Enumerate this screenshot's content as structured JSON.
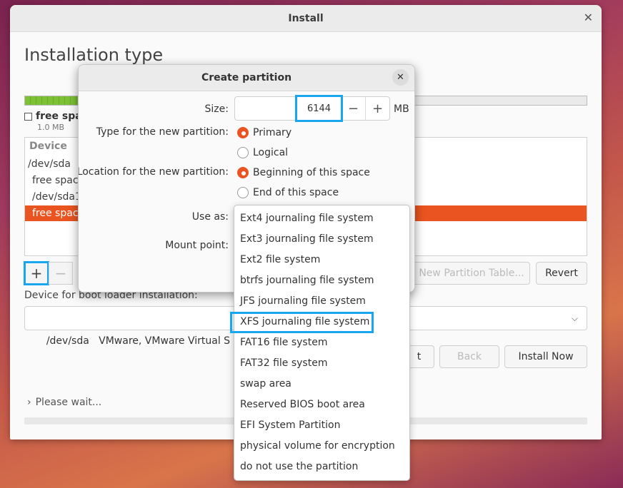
{
  "installer": {
    "title": "Install",
    "close_glyph": "✕",
    "heading": "Installation type",
    "legend_label": "free spa",
    "legend_size": "1.0 MB",
    "device_column": "Device",
    "devices": [
      "/dev/sda",
      "free space",
      "/dev/sda1",
      "free space"
    ],
    "add_glyph": "+",
    "remove_glyph": "−",
    "new_table_label": "New Partition Table...",
    "revert_label": "Revert",
    "boot_label": "Device for boot loader installation:",
    "boot_value": "/dev/sda   VMware, VMware Virtual S (21",
    "back_partial_label": "t",
    "back_label": "Back",
    "install_label": "Install Now",
    "wait_text": "Please wait..."
  },
  "dialog": {
    "title": "Create partition",
    "size_label": "Size:",
    "size_value": "6144",
    "size_unit": "MB",
    "minus_glyph": "−",
    "plus_glyph": "+",
    "type_label": "Type for the new partition:",
    "type_options": [
      "Primary",
      "Logical"
    ],
    "type_selected": "Primary",
    "location_label": "Location for the new partition:",
    "location_options": [
      "Beginning of this space",
      "End of this space"
    ],
    "location_selected": "Beginning of this space",
    "use_as_label": "Use as:",
    "mount_label": "Mount point:",
    "use_as_options": [
      "Ext4 journaling file system",
      "Ext3 journaling file system",
      "Ext2 file system",
      "btrfs journaling file system",
      "JFS journaling file system",
      "XFS journaling file system",
      "FAT16 file system",
      "FAT32 file system",
      "swap area",
      "Reserved BIOS boot area",
      "EFI System Partition",
      "physical volume for encryption",
      "do not use the partition"
    ],
    "highlighted_option": "XFS journaling file system"
  },
  "colors": {
    "accent": "#e95420",
    "highlight": "#18a6ee",
    "used_space": "#7cc136"
  }
}
